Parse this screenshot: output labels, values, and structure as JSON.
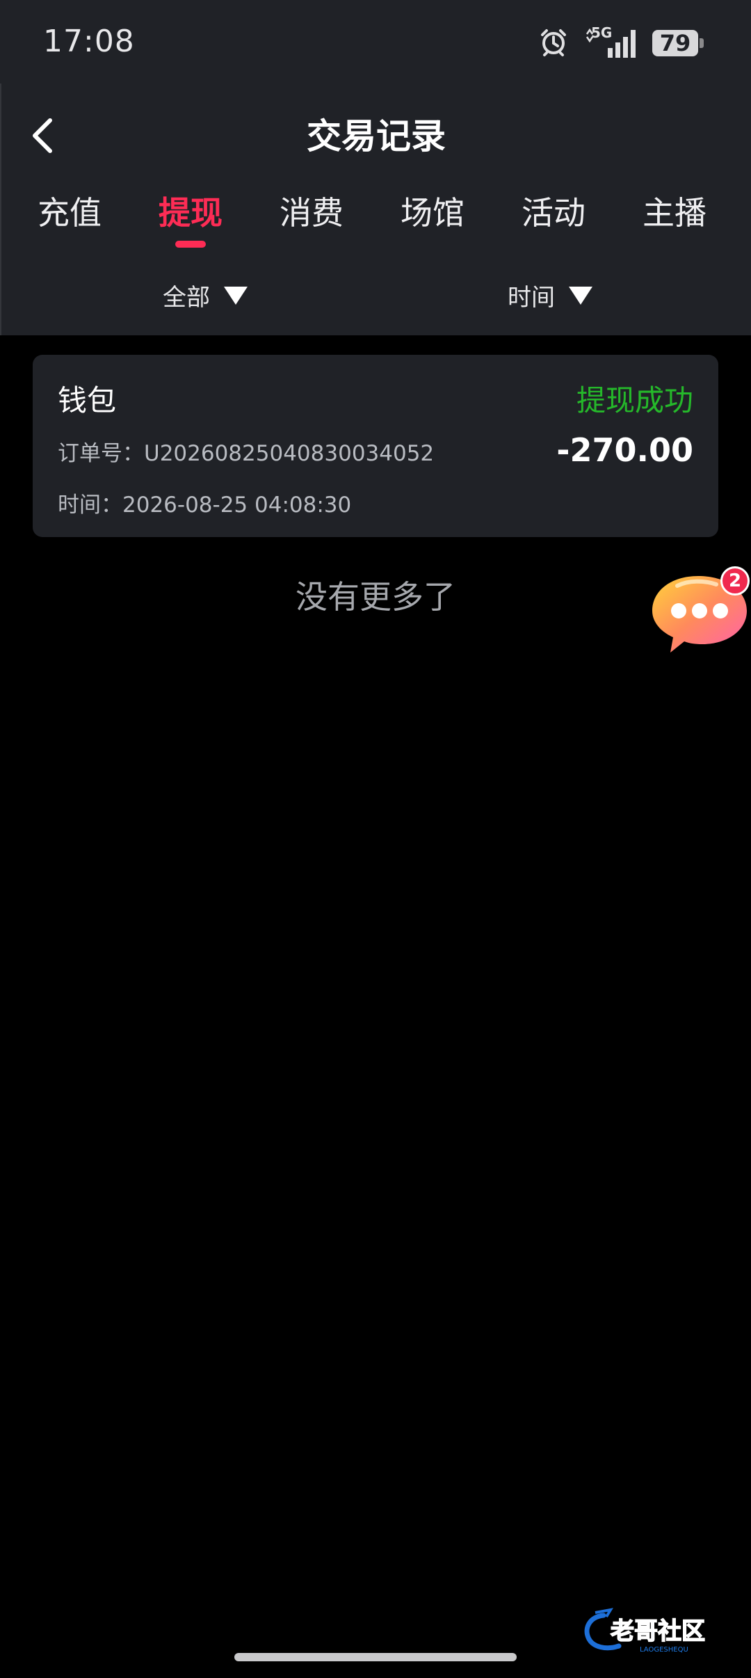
{
  "status_bar": {
    "time": "17:08",
    "network": "5G",
    "battery": "79"
  },
  "header": {
    "title": "交易记录"
  },
  "tabs": [
    {
      "label": "充值",
      "active": false
    },
    {
      "label": "提现",
      "active": true
    },
    {
      "label": "消费",
      "active": false
    },
    {
      "label": "场馆",
      "active": false
    },
    {
      "label": "活动",
      "active": false
    },
    {
      "label": "主播",
      "active": false
    }
  ],
  "filters": {
    "type": "全部",
    "time": "时间"
  },
  "records": [
    {
      "title": "钱包",
      "status": "提现成功",
      "order": "订单号：U20260825040830034052",
      "time": "时间：2026-08-25 04:08:30",
      "amount": "-270.00"
    }
  ],
  "footer_text": "没有更多了",
  "chat": {
    "badge": "2"
  },
  "watermark": {
    "text": "老哥社区",
    "subtext": "LAOGESHEQU"
  },
  "colors": {
    "accent": "#fe2c55",
    "success": "#25b82a",
    "panel": "#202227",
    "background": "#000000"
  },
  "icons": [
    "back-arrow-icon",
    "alarm-icon",
    "signal-icon",
    "battery-icon",
    "dropdown-triangle-icon",
    "chat-bubble-icon"
  ]
}
